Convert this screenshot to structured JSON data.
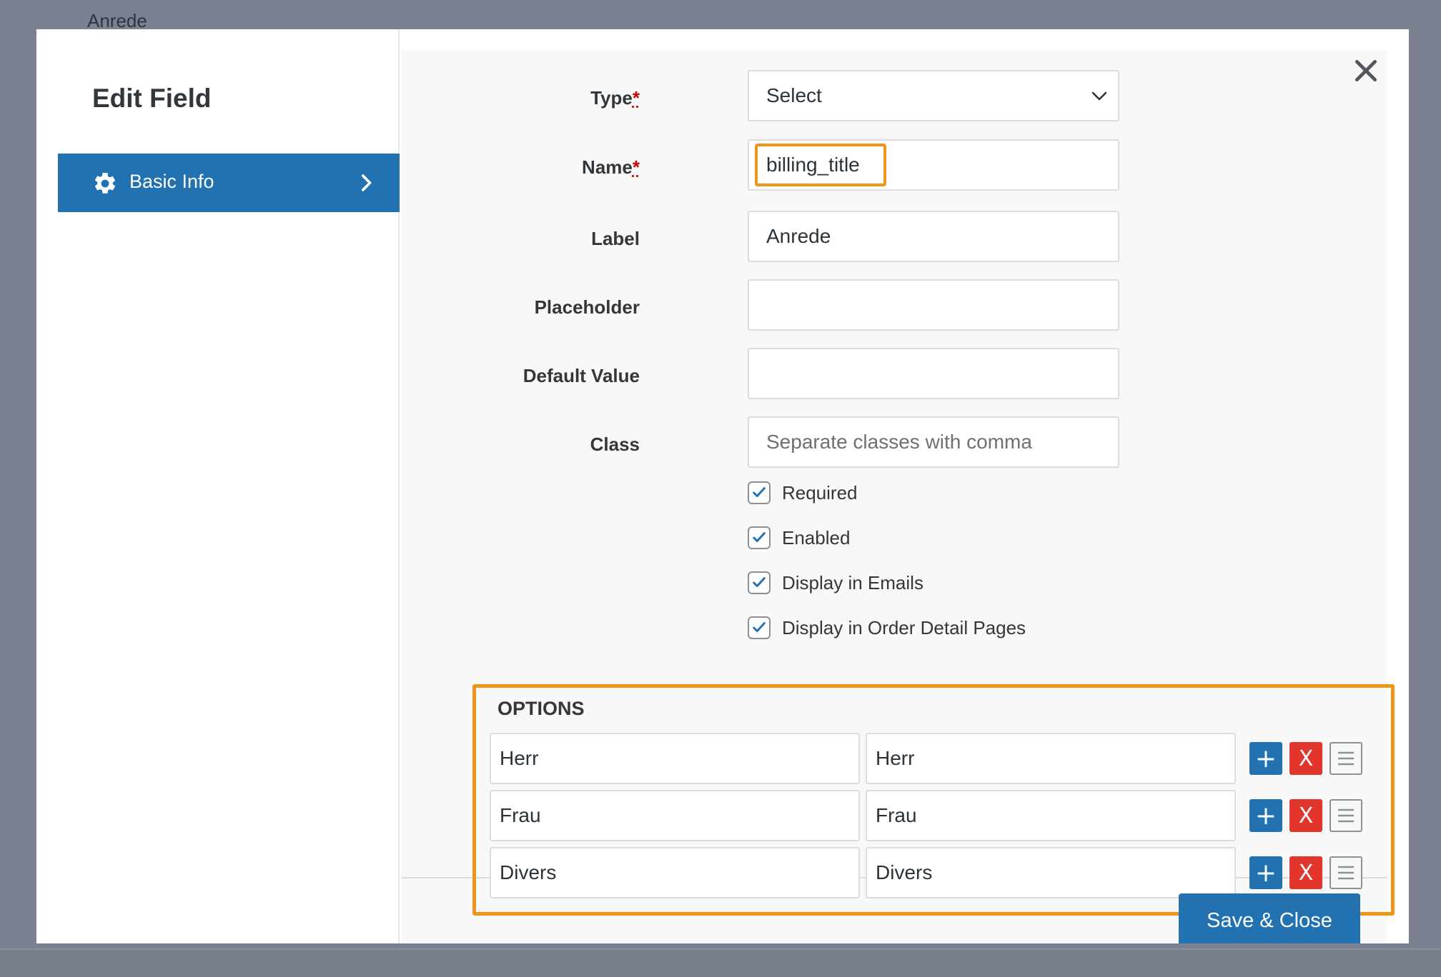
{
  "background": {
    "label_text": "Anrede"
  },
  "modal": {
    "title": "Edit Field",
    "close_icon": "close-icon",
    "sidebar": {
      "items": [
        {
          "label": "Basic Info",
          "icon": "gear-icon",
          "active": true,
          "color": "#2271b1"
        }
      ]
    },
    "form": {
      "type": {
        "label": "Type",
        "required_mark": "*",
        "value": "Select"
      },
      "name": {
        "label": "Name",
        "required_mark": "*",
        "value": "billing_title"
      },
      "label": {
        "label": "Label",
        "value": "Anrede"
      },
      "placeholder": {
        "label": "Placeholder",
        "value": ""
      },
      "default_value": {
        "label": "Default Value",
        "value": ""
      },
      "class": {
        "label": "Class",
        "placeholder": "Separate classes with comma"
      },
      "checkboxes": [
        {
          "label": "Required",
          "checked": true
        },
        {
          "label": "Enabled",
          "checked": true
        },
        {
          "label": "Display in Emails",
          "checked": true
        },
        {
          "label": "Display in Order Detail Pages",
          "checked": true
        }
      ]
    },
    "options": {
      "title": "OPTIONS",
      "highlight_color": "#f0931a",
      "rows": [
        {
          "key": "Herr",
          "value": "Herr"
        },
        {
          "key": "Frau",
          "value": "Frau"
        },
        {
          "key": "Divers",
          "value": "Divers"
        }
      ],
      "add_label": "+",
      "remove_label": "X"
    },
    "save_label": "Save & Close"
  }
}
